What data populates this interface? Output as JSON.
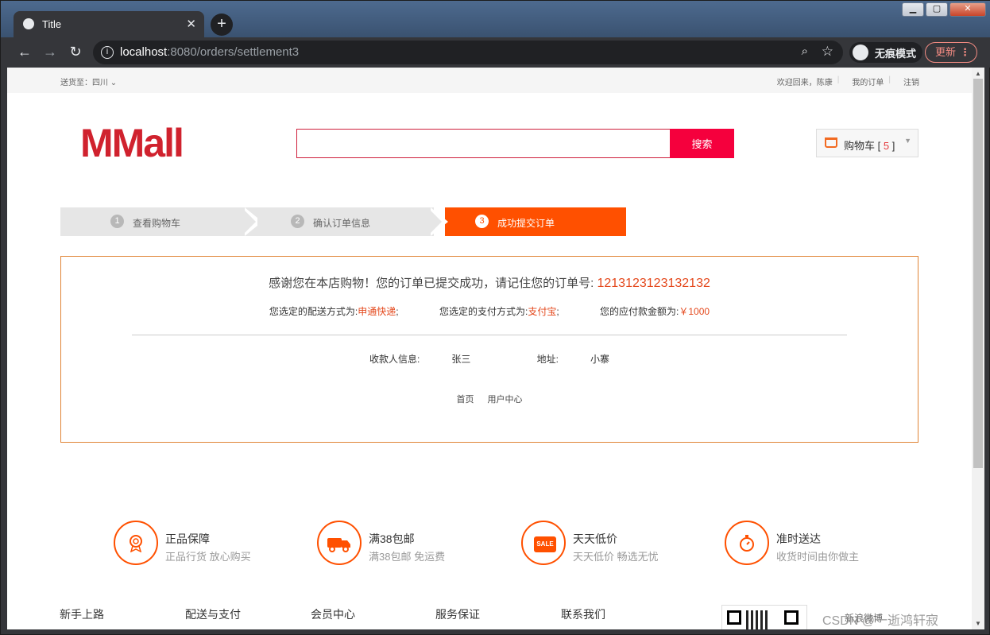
{
  "browser": {
    "tab_title": "Title",
    "url_host": "localhost",
    "url_rest": ":8080/orders/settlement3",
    "incognito_label": "无痕模式",
    "update_label": "更新"
  },
  "topbar": {
    "ship_to_label": "送货至：",
    "ship_to_value": "四川",
    "welcome": "欢迎回来，陈康",
    "my_orders": "我的订单",
    "logout": "注销"
  },
  "header": {
    "logo": "MMall",
    "search_button": "搜索",
    "cart_label": "购物车",
    "cart_count": "5"
  },
  "steps": [
    {
      "num": "1",
      "label": "查看购物车"
    },
    {
      "num": "2",
      "label": "确认订单信息"
    },
    {
      "num": "3",
      "label": "成功提交订单"
    }
  ],
  "success": {
    "thanks_text": "感谢您在本店购物！您的订单已提交成功，请记住您的订单号:",
    "order_number": "1213123123132132",
    "shipping_label": "您选定的配送方式为:",
    "shipping_value": "申通快递",
    "payment_label": "您选定的支付方式为:",
    "payment_value": "支付宝",
    "amount_label": "您的应付款金额为:",
    "amount_value": "￥1000",
    "payee_label": "收款人信息:",
    "payee_value": "张三",
    "address_label": "地址:",
    "address_value": "小寨",
    "link_home": "首页",
    "link_user_center": "用户中心"
  },
  "features": [
    {
      "icon": "badge-icon",
      "title": "正品保障",
      "subtitle": "正品行货 放心购买"
    },
    {
      "icon": "truck-icon",
      "title": "满38包邮",
      "subtitle": "满38包邮 免运费"
    },
    {
      "icon": "sale-tag-icon",
      "title": "天天低价",
      "subtitle": "天天低价 畅选无忧",
      "badge_text": "SALE"
    },
    {
      "icon": "stopwatch-icon",
      "title": "准时送达",
      "subtitle": "收货时间由你做主"
    }
  ],
  "footer": {
    "columns": [
      "新手上路",
      "配送与支付",
      "会员中心",
      "服务保证",
      "联系我们"
    ],
    "weibo": "新浪微博"
  },
  "watermark": "CSDN @一逝鸿轩寂",
  "colors": {
    "accent": "#ff5000",
    "logo": "#d0222e",
    "search_button": "#f5003d",
    "highlight": "#e4481c"
  }
}
